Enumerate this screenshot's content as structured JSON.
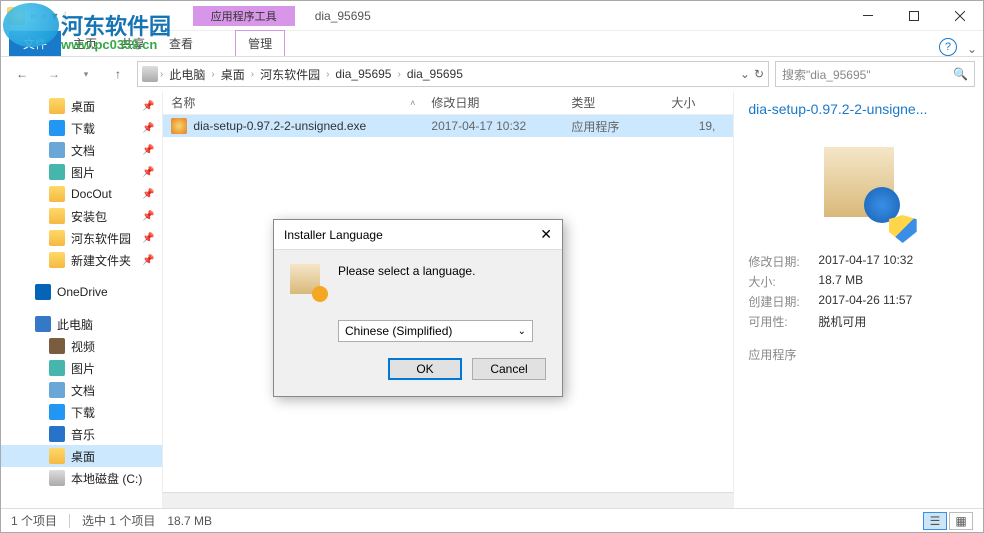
{
  "watermark": {
    "text1": "河东软件园",
    "text2": "www.pc0359.cn"
  },
  "titlebar": {
    "context_tab": "应用程序工具",
    "title": "dia_95695"
  },
  "ribbon": {
    "file": "文件",
    "home": "主页",
    "share": "共享",
    "view": "查看",
    "manage": "管理"
  },
  "breadcrumb": [
    "此电脑",
    "桌面",
    "河东软件园",
    "dia_95695",
    "dia_95695"
  ],
  "search": {
    "placeholder": "搜索\"dia_95695\""
  },
  "sidebar": [
    {
      "label": "桌面",
      "lvl": 1,
      "icon": "folder",
      "pin": true
    },
    {
      "label": "下载",
      "lvl": 1,
      "icon": "download",
      "pin": true
    },
    {
      "label": "文档",
      "lvl": 1,
      "icon": "doc",
      "pin": true
    },
    {
      "label": "图片",
      "lvl": 1,
      "icon": "pic",
      "pin": true
    },
    {
      "label": "DocOut",
      "lvl": 1,
      "icon": "folder",
      "pin": true
    },
    {
      "label": "安装包",
      "lvl": 1,
      "icon": "folder",
      "pin": true
    },
    {
      "label": "河东软件园",
      "lvl": 1,
      "icon": "folder",
      "pin": true
    },
    {
      "label": "新建文件夹",
      "lvl": 1,
      "icon": "folder",
      "pin": true
    },
    {
      "label": "OneDrive",
      "lvl": 0,
      "icon": "onedrive"
    },
    {
      "label": "此电脑",
      "lvl": 0,
      "icon": "pc"
    },
    {
      "label": "视频",
      "lvl": 1,
      "icon": "video"
    },
    {
      "label": "图片",
      "lvl": 1,
      "icon": "pic"
    },
    {
      "label": "文档",
      "lvl": 1,
      "icon": "doc"
    },
    {
      "label": "下载",
      "lvl": 1,
      "icon": "download"
    },
    {
      "label": "音乐",
      "lvl": 1,
      "icon": "music"
    },
    {
      "label": "桌面",
      "lvl": 1,
      "icon": "folder",
      "sel": true
    },
    {
      "label": "本地磁盘 (C:)",
      "lvl": 1,
      "icon": "disk"
    }
  ],
  "columns": {
    "name": "名称",
    "date": "修改日期",
    "type": "类型",
    "size": "大小"
  },
  "rows": [
    {
      "name": "dia-setup-0.97.2-2-unsigned.exe",
      "date": "2017-04-17 10:32",
      "type": "应用程序",
      "size": "19,"
    }
  ],
  "details": {
    "title": "dia-setup-0.97.2-2-unsigne...",
    "modified_label": "修改日期:",
    "modified": "2017-04-17 10:32",
    "size_label": "大小:",
    "size": "18.7 MB",
    "created_label": "创建日期:",
    "created": "2017-04-26 11:57",
    "avail_label": "可用性:",
    "avail": "脱机可用",
    "type": "应用程序"
  },
  "status": {
    "count": "1 个项目",
    "selected": "选中 1 个项目",
    "size": "18.7 MB"
  },
  "dialog": {
    "title": "Installer Language",
    "message": "Please select a language.",
    "selected": "Chinese (Simplified)",
    "ok": "OK",
    "cancel": "Cancel"
  }
}
